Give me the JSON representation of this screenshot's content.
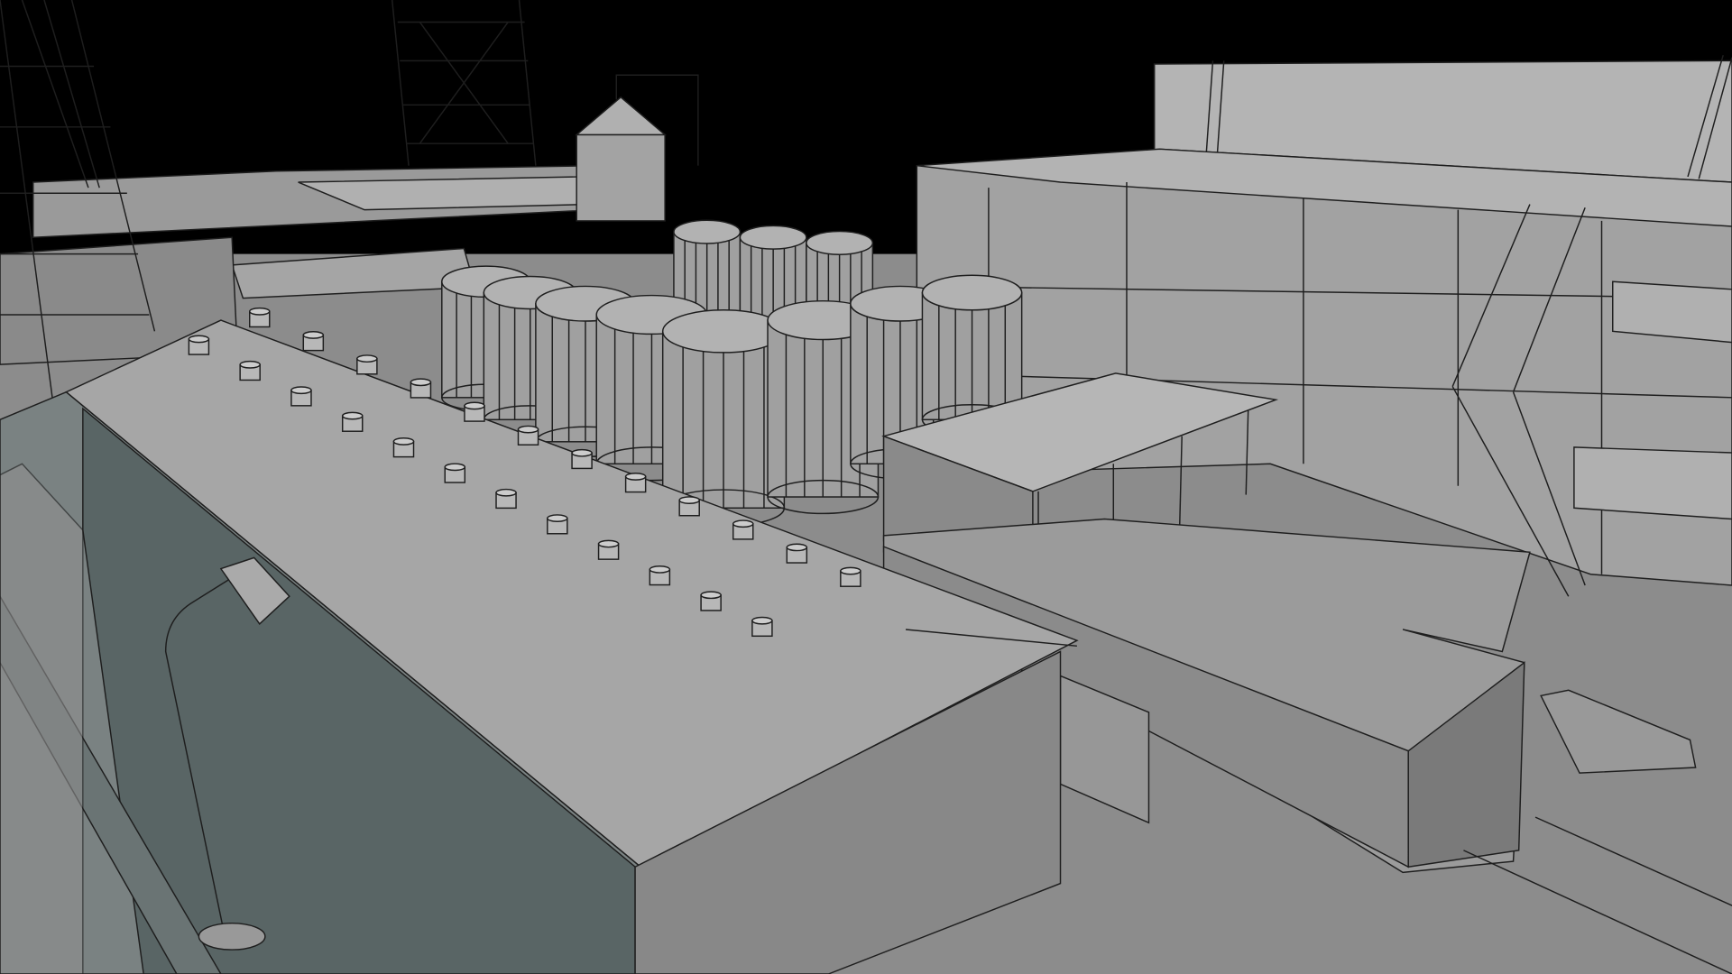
{
  "colors": {
    "sky": "#000000",
    "ground": "#8c8c8c",
    "roof_light": "#a9a9a9",
    "wall_mid": "#7e7e7e",
    "wall_teal": "#5a6665",
    "silo": "#9d9d9d",
    "edge": "#1e1e1e"
  }
}
